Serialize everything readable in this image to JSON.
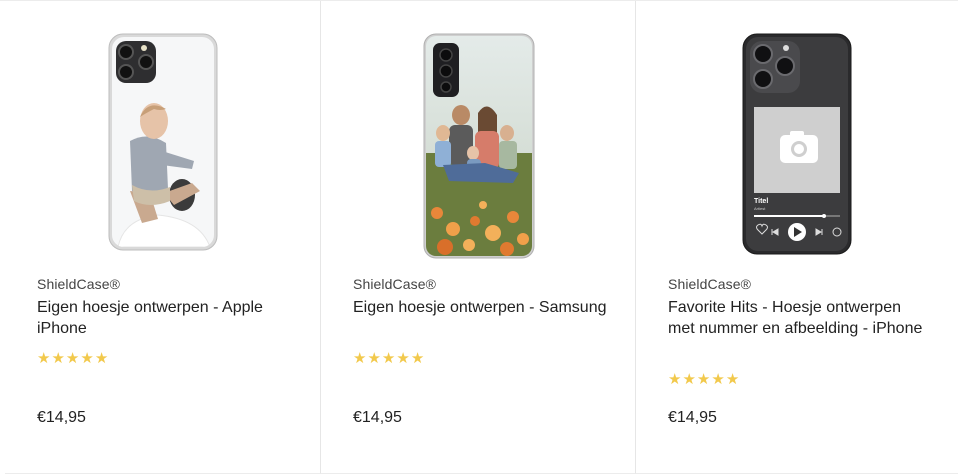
{
  "products": [
    {
      "brand": "ShieldCase®",
      "title": "Eigen hoesje ontwerpen - Apple iPhone",
      "rating": 5,
      "price": "€14,95",
      "image_icon": "iphone-case-baby-photo"
    },
    {
      "brand": "ShieldCase®",
      "title": "Eigen hoesje ontwerpen - Samsung",
      "rating": 5,
      "price": "€14,95",
      "image_icon": "samsung-case-family-photo"
    },
    {
      "brand": "ShieldCase®",
      "title": "Favorite Hits - Hoesje ontwerpen met nummer en afbeelding - iPhone",
      "rating": 5,
      "price": "€14,95",
      "image_icon": "iphone-case-music-player",
      "mock_player": {
        "song": "Titel",
        "artist": "Artiest"
      }
    }
  ],
  "colors": {
    "star": "#f2c94c",
    "text": "#222222",
    "divider": "#ececec"
  }
}
